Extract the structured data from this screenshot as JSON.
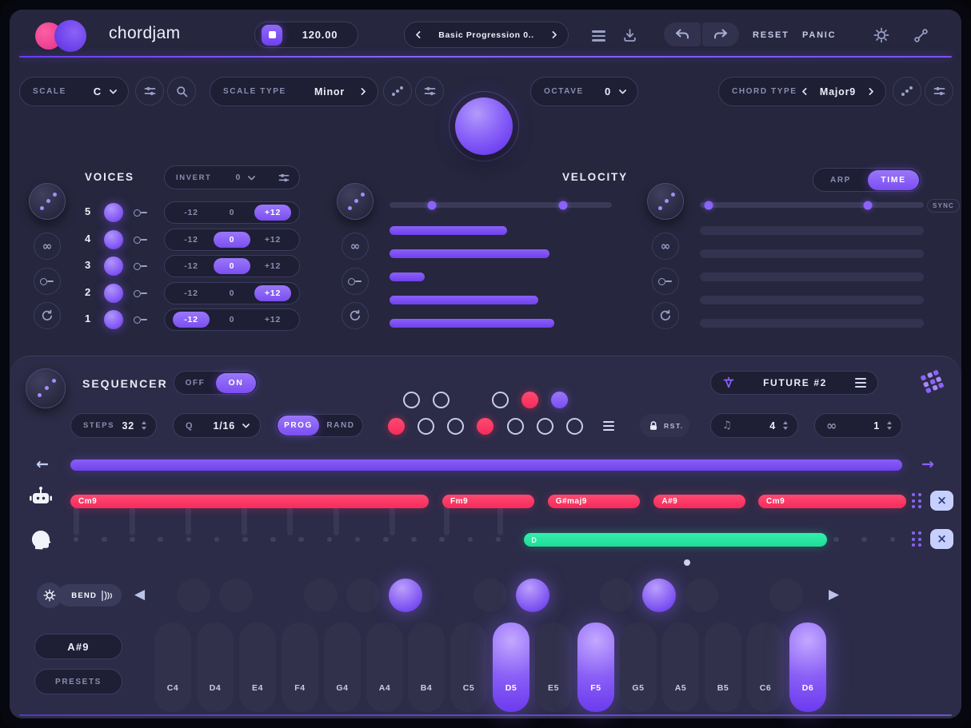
{
  "header": {
    "logo": "chordjam",
    "bpm": "120.00",
    "preset": "Basic Progression 0..",
    "reset": "RESET",
    "panic": "PANIC"
  },
  "controls": {
    "scale_label": "SCALE",
    "scale_value": "C",
    "scale_type_label": "SCALE TYPE",
    "scale_type_value": "Minor",
    "octave_label": "OCTAVE",
    "octave_value": "0",
    "chord_type_label": "CHORD TYPE",
    "chord_type_value": "Major9"
  },
  "voices": {
    "title": "VOICES",
    "invert_label": "INVERT",
    "invert_value": "0",
    "options": [
      "-12",
      "0",
      "+12"
    ],
    "rows": [
      {
        "num": "5",
        "selected": "+12"
      },
      {
        "num": "4",
        "selected": "0"
      },
      {
        "num": "3",
        "selected": "0"
      },
      {
        "num": "2",
        "selected": "+12"
      },
      {
        "num": "1",
        "selected": "-12"
      }
    ]
  },
  "velocity": {
    "title": "VELOCITY",
    "range_pct": [
      19,
      78
    ],
    "bars_pct": [
      53,
      72,
      16,
      67,
      74
    ]
  },
  "arp_time": {
    "arp": "ARP",
    "time": "TIME",
    "active": "TIME",
    "sync": "SYNC",
    "range_pct": [
      4,
      75
    ],
    "bars_pct": [
      0,
      0,
      0,
      0,
      0
    ]
  },
  "sequencer": {
    "title": "SEQUENCER",
    "off": "OFF",
    "on": "ON",
    "preset": "FUTURE #2",
    "steps_label": "STEPS",
    "steps_value": "32",
    "quant_label": "Q",
    "quant_value": "1/16",
    "prog": "PROG",
    "rand": "RAND",
    "rst": "RST.",
    "note_div": "4",
    "loop_count": "1",
    "step_rows": [
      [
        "empty",
        "empty",
        "none",
        "empty",
        "pink",
        "purple"
      ],
      [
        "pink",
        "empty",
        "empty",
        "pink",
        "empty",
        "empty",
        "empty"
      ]
    ],
    "chords": [
      {
        "label": "Cm9",
        "start_pct": 0,
        "width_pct": 42.9
      },
      {
        "label": "Fm9",
        "start_pct": 44.5,
        "width_pct": 11
      },
      {
        "label": "G#maj9",
        "start_pct": 57.1,
        "width_pct": 11
      },
      {
        "label": "A#9",
        "start_pct": 69.8,
        "width_pct": 11
      },
      {
        "label": "Cm9",
        "start_pct": 82.3,
        "width_pct": 17.7
      }
    ],
    "note_bar": {
      "label": "D",
      "start_pct": 54.3,
      "width_pct": 36.2
    }
  },
  "keyboard": {
    "bend": "BEND",
    "current_chord": "A#9",
    "presets": "PRESETS",
    "white_keys": [
      "C4",
      "D4",
      "E4",
      "F4",
      "G4",
      "A4",
      "B4",
      "C5",
      "D5",
      "E5",
      "F5",
      "G5",
      "A5",
      "B5",
      "C6",
      "D6"
    ],
    "lit_white_keys": [
      "D5",
      "F5",
      "D6"
    ],
    "black_pads": [
      {
        "note": "C#4",
        "after": 0,
        "lit": false
      },
      {
        "note": "D#4",
        "after": 1,
        "lit": false
      },
      {
        "note": "F#4",
        "after": 3,
        "lit": false
      },
      {
        "note": "G#4",
        "after": 4,
        "lit": false
      },
      {
        "note": "A#4",
        "after": 5,
        "lit": true
      },
      {
        "note": "C#5",
        "after": 7,
        "lit": false
      },
      {
        "note": "D#5",
        "after": 8,
        "lit": true
      },
      {
        "note": "F#5",
        "after": 10,
        "lit": false
      },
      {
        "note": "G#5",
        "after": 11,
        "lit": true
      },
      {
        "note": "A#5",
        "after": 12,
        "lit": false
      },
      {
        "note": "C#6",
        "after": 14,
        "lit": false
      }
    ]
  },
  "icons": {
    "infinity": "∞",
    "note": "♫",
    "loop": "∞",
    "multiply_x": "×",
    "arrow_left": "←",
    "arrow_right": "→",
    "triangle_left": "◀",
    "triangle_right": "▶"
  },
  "colors": {
    "accent_purple": "#7b4ef2",
    "accent_pink": "#f72b5b",
    "accent_green": "#1fdd97",
    "background": "#26263e",
    "panel": "#2c2c48"
  }
}
